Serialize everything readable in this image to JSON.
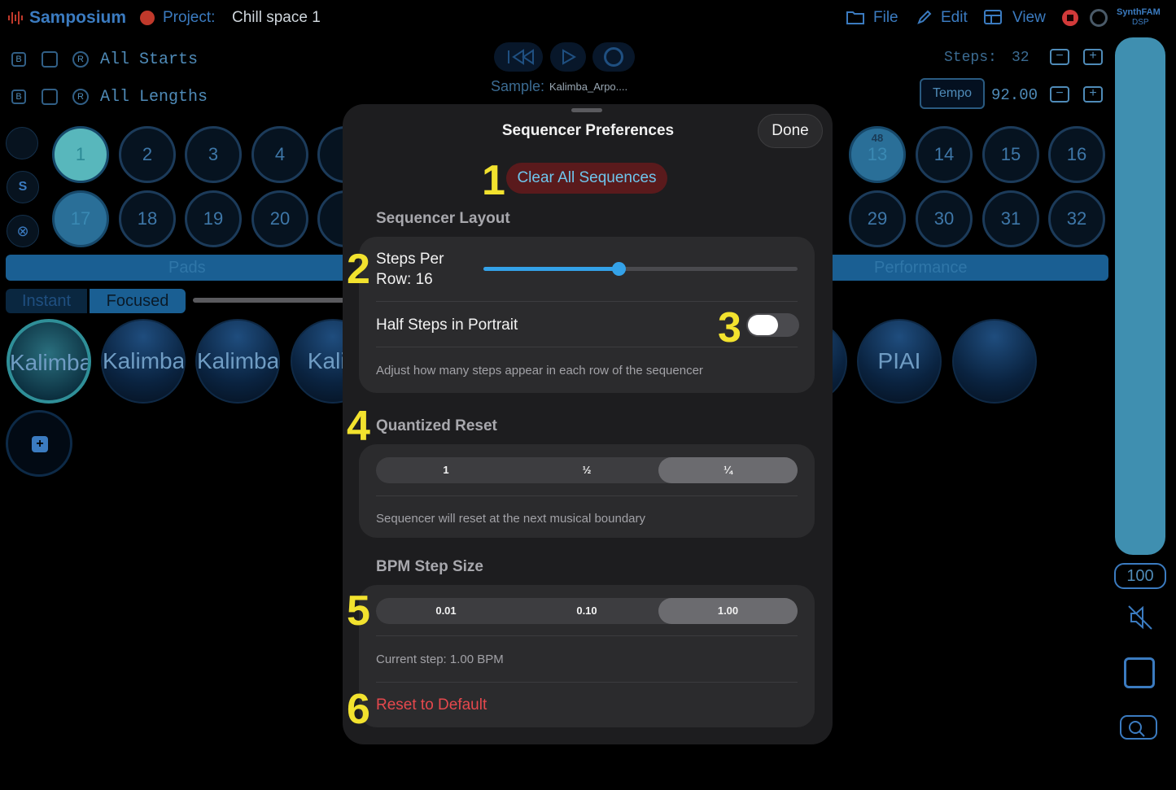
{
  "app": {
    "name": "Samposium",
    "project_label": "Project:",
    "project_name": "Chill space 1",
    "brand_top": "SynthFAM",
    "brand_bottom": "DSP"
  },
  "menu": {
    "file": "File",
    "edit": "Edit",
    "view": "View"
  },
  "rows": {
    "starts_label": "All Starts",
    "lengths_label": "All Lengths",
    "b": "B",
    "r": "R"
  },
  "transport": {
    "sample_label": "Sample:",
    "sample_name": "Kalimba_Arpo...."
  },
  "steps": {
    "label": "Steps:",
    "value": "32"
  },
  "tempo": {
    "label": "Tempo",
    "value": "92.00"
  },
  "side": {
    "s": "S"
  },
  "pads_row1": [
    "1",
    "2",
    "3",
    "4"
  ],
  "pads_row1_right": [
    "13",
    "14",
    "15",
    "16"
  ],
  "pad13_badge": "48",
  "pads_row2": [
    "17",
    "18",
    "19",
    "20"
  ],
  "pads_row2_right": [
    "29",
    "30",
    "31",
    "32"
  ],
  "tabs": {
    "pads": "Pads",
    "performance": "Performance",
    "instant": "Instant",
    "focused": "Focused"
  },
  "instruments": [
    "Kalimba",
    "Kalimba",
    "Kalimba",
    "Kalin"
  ],
  "instruments_right": [
    "PIAI",
    ""
  ],
  "level": "100",
  "sheet": {
    "title": "Sequencer Preferences",
    "done": "Done",
    "clear_all": "Clear All Sequences",
    "layout_header": "Sequencer Layout",
    "steps_per_row_line1": "Steps Per",
    "steps_per_row_line2": "Row: 16",
    "steps_slider_fraction": 0.43,
    "half_steps_label": "Half Steps in Portrait",
    "half_steps_on": false,
    "layout_footer": "Adjust how many steps appear in each row of the sequencer",
    "quantized_header": "Quantized Reset",
    "quantized_options": [
      "1",
      "½",
      "¼"
    ],
    "quantized_selected": "¼",
    "quantized_footer": "Sequencer will reset at the next musical boundary",
    "bpm_header": "BPM Step Size",
    "bpm_options": [
      "0.01",
      "0.10",
      "1.00"
    ],
    "bpm_selected": "1.00",
    "bpm_current": "Current step: 1.00 BPM",
    "reset_default": "Reset to Default"
  },
  "annotations": [
    "1",
    "2",
    "3",
    "4",
    "5",
    "6"
  ],
  "colors": {
    "accent": "#3b7bc0",
    "sheet_bg": "#1d1d1f",
    "annotation": "#f2e22e",
    "danger": "#e5484d",
    "clear_text": "#6ec5ec"
  }
}
